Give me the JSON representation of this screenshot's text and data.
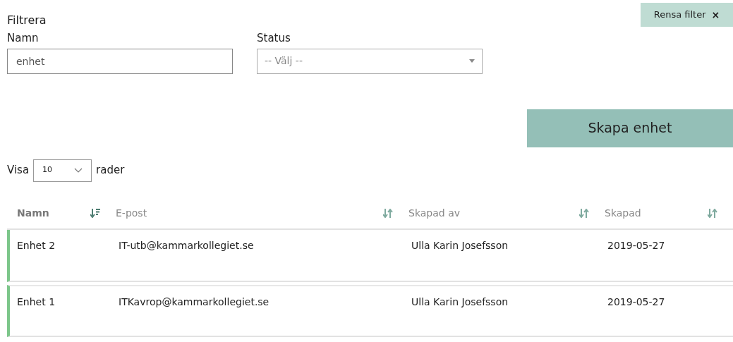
{
  "filter": {
    "title": "Filtrera",
    "clear_button": "Rensa filter",
    "clear_icon": "×",
    "fields": [
      {
        "label": "Namn",
        "kind": "text",
        "value": "enhet"
      },
      {
        "label": "Status",
        "kind": "select",
        "placeholder": "-- Välj --"
      }
    ]
  },
  "create_button": "Skapa enhet",
  "page_size": {
    "before": "Visa",
    "value": "10",
    "after": "rader"
  },
  "table": {
    "columns": [
      {
        "label": "Namn",
        "sorted": true
      },
      {
        "label": "E-post",
        "sorted": false
      },
      {
        "label": "Skapad av",
        "sorted": false
      },
      {
        "label": "Skapad",
        "sorted": false
      }
    ],
    "rows": [
      [
        "Enhet 2",
        "IT-utb@kammarkollegiet.se",
        "Ulla Karin Josefsson",
        "2019-05-27"
      ],
      [
        "Enhet 1",
        "ITKavrop@kammarkollegiet.se",
        "Ulla Karin Josefsson",
        "2019-05-27"
      ]
    ]
  }
}
